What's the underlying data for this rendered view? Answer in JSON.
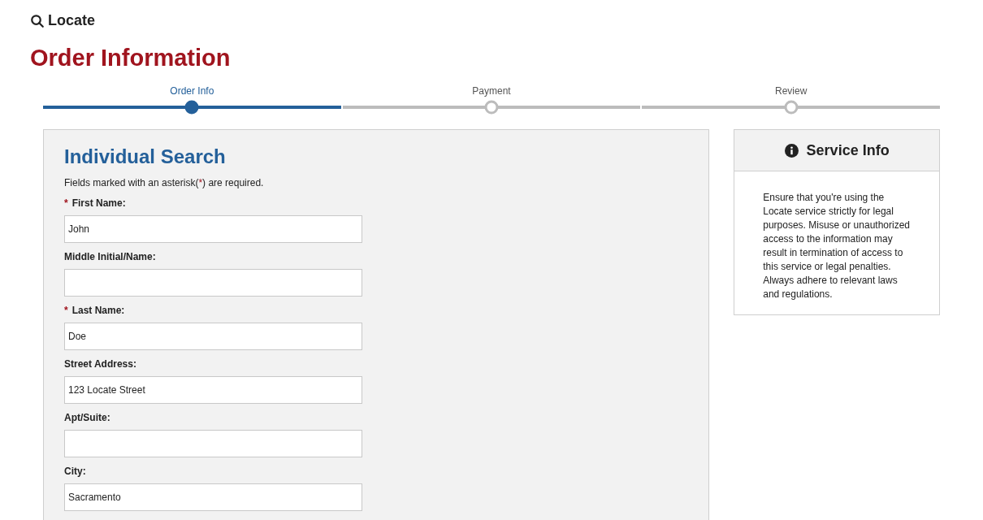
{
  "app": {
    "name": "Locate"
  },
  "page_title": "Order Information",
  "steps": [
    {
      "label": "Order Info",
      "selected": true
    },
    {
      "label": "Payment",
      "selected": false
    },
    {
      "label": "Review",
      "selected": false
    }
  ],
  "form": {
    "title": "Individual Search",
    "note": {
      "before": "Fields marked with an asterisk(",
      "mark": "*",
      "after": ") are required."
    },
    "fields": [
      {
        "label": "First Name:",
        "required": true,
        "value": "John"
      },
      {
        "label": "Middle Initial/Name:",
        "required": false
      },
      {
        "label": "Last Name:",
        "required": true,
        "value": "Doe"
      },
      {
        "label": "Street Address:",
        "required": false,
        "value": "123 Locate Street"
      },
      {
        "label": "Apt/Suite:",
        "required": false
      },
      {
        "label": "City:",
        "required": false,
        "value": "Sacramento"
      }
    ]
  },
  "service_info": {
    "title": "Service Info",
    "text": "Ensure that you're using the Locate service strictly for legal purposes. Misuse or unauthorized access to the information may result in termination of access to this service or legal penalties. Always adhere to relevant laws and regulations."
  }
}
